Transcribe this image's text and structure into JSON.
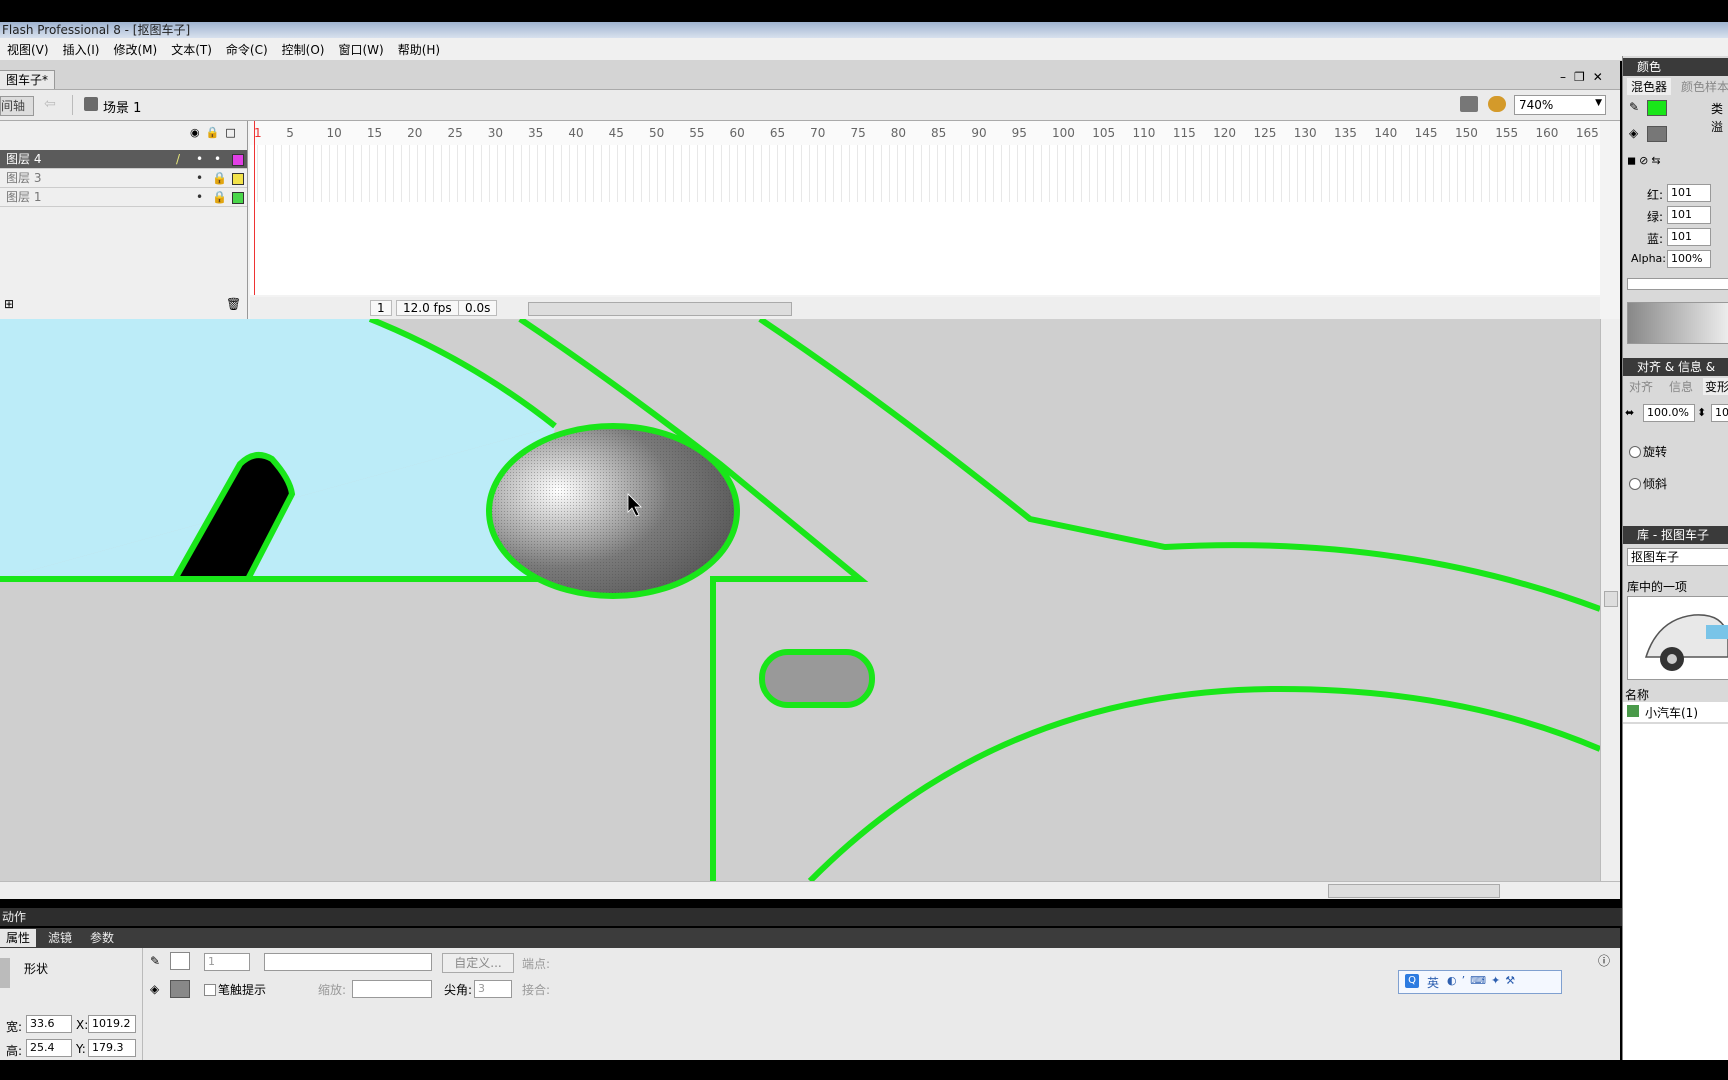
{
  "window": {
    "title": "Flash Professional 8 - [抠图车子]"
  },
  "menu": [
    "视图(V)",
    "插入(I)",
    "修改(M)",
    "文本(T)",
    "命令(C)",
    "控制(O)",
    "窗口(W)",
    "帮助(H)"
  ],
  "document": {
    "tab": "图车子*",
    "timeline_btn": "间轴",
    "scene": "场景 1",
    "zoom": "740%"
  },
  "layers": [
    {
      "name": "图层 4",
      "selected": true,
      "color": "#e23fe6"
    },
    {
      "name": "图层 3",
      "selected": false,
      "color": "#f2e24a"
    },
    {
      "name": "图层 1",
      "selected": false,
      "color": "#4ad64a"
    }
  ],
  "ruler": [
    "1",
    "5",
    "10",
    "15",
    "20",
    "25",
    "30",
    "35",
    "40",
    "45",
    "50",
    "55",
    "60",
    "65",
    "70",
    "75",
    "80",
    "85",
    "90",
    "95",
    "100",
    "105",
    "110",
    "115",
    "120",
    "125",
    "130",
    "135",
    "140",
    "145",
    "150",
    "155",
    "160",
    "165"
  ],
  "timeline_status": {
    "frame": "1",
    "fps": "12.0 fps",
    "time": "0.0s"
  },
  "actions_panel": {
    "title": "动作"
  },
  "properties": {
    "tabs": [
      "属性",
      "滤镜",
      "参数"
    ],
    "shape_label": "形状",
    "stroke_height": "1",
    "custom_btn": "自定义...",
    "cap_label": "端点:",
    "stroke_hint": "笔触提示",
    "scale_label": "缩放:",
    "miter_label": "尖角:",
    "miter_value": "3",
    "join_label": "接合:",
    "w_label": "宽:",
    "w": "33.6",
    "h_label": "高:",
    "h": "25.4",
    "x_label": "X:",
    "x": "1019.2",
    "y_label": "Y:",
    "y": "179.3"
  },
  "ime": {
    "lang": "英"
  },
  "color_panel": {
    "title": "颜色",
    "tab1": "混色器",
    "tab2": "颜色样本",
    "type_label": "类",
    "overflow_label": "溢",
    "r_label": "红:",
    "r": "101",
    "g_label": "绿:",
    "g": "101",
    "b_label": "蓝:",
    "b": "101",
    "alpha_label": "Alpha:",
    "alpha": "100%"
  },
  "align_panel": {
    "title": "对齐 & 信息 &",
    "tabs": [
      "对齐",
      "信息",
      "变形"
    ],
    "scale_w": "100.0%",
    "scale_h": "10",
    "rotate": "旋转",
    "skew": "倾斜"
  },
  "library_panel": {
    "title": "库 - 抠图车子",
    "doc": "抠图车子",
    "count": "库中的一项",
    "name_col": "名称",
    "item": "小汽车(1)"
  },
  "colors": {
    "stroke": "#19e619",
    "stage": "#cccccc",
    "sky": "#bcecf8"
  }
}
